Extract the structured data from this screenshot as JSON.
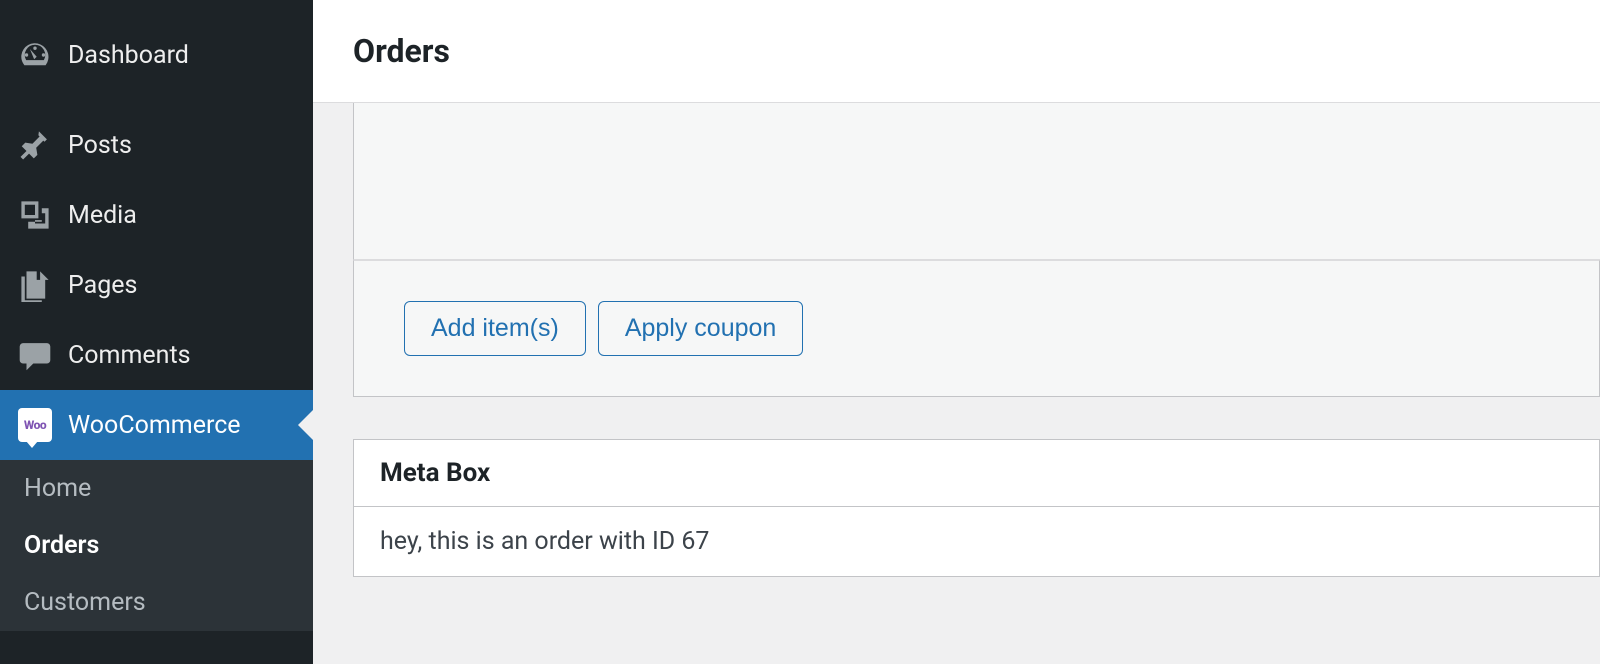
{
  "sidebar": {
    "dashboard_label": "Dashboard",
    "posts_label": "Posts",
    "media_label": "Media",
    "pages_label": "Pages",
    "comments_label": "Comments",
    "woocommerce_label": "WooCommerce",
    "woo_badge_text": "Woo",
    "submenu": {
      "home_label": "Home",
      "orders_label": "Orders",
      "customers_label": "Customers"
    }
  },
  "header": {
    "title": "Orders"
  },
  "actions": {
    "add_item_label": "Add item(s)",
    "apply_coupon_label": "Apply coupon"
  },
  "metabox": {
    "title": "Meta Box",
    "content": "hey, this is an order with ID 67"
  }
}
